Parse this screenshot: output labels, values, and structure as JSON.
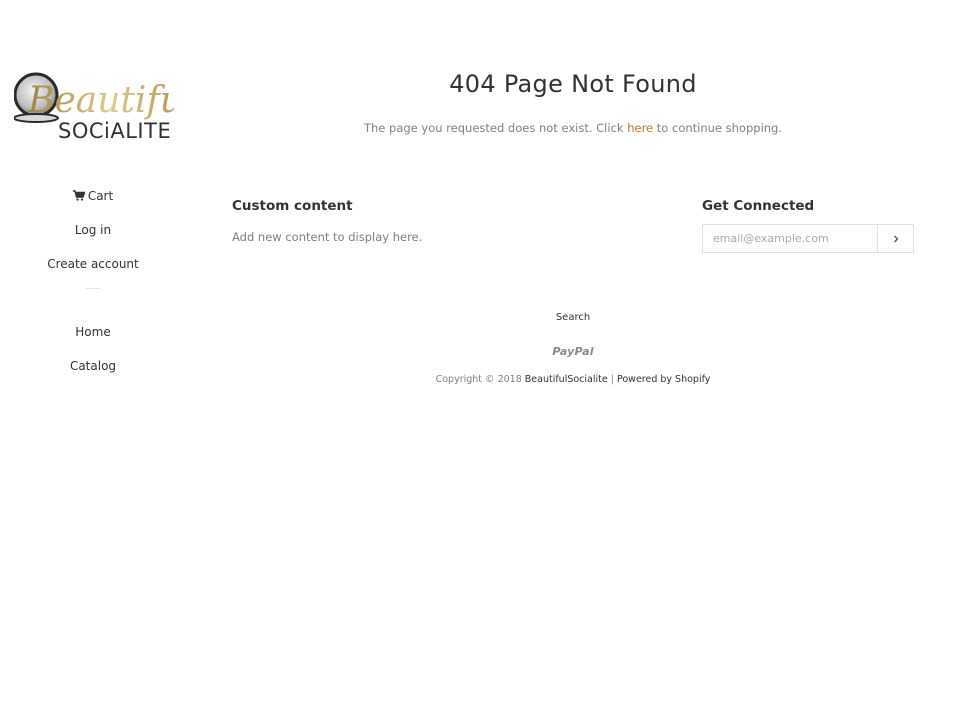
{
  "brand": {
    "logo_script": "Beautiful",
    "logo_text": "SOCiALITE",
    "gold": "#b89a4a",
    "dark": "#333333"
  },
  "sidebar": {
    "items": [
      {
        "label": "Cart",
        "icon": "cart-icon"
      },
      {
        "label": "Log in"
      },
      {
        "label": "Create account"
      },
      {
        "label": "Home"
      },
      {
        "label": "Catalog"
      }
    ]
  },
  "main": {
    "title": "404 Page Not Found",
    "message_before": "The page you requested does not exist. Click ",
    "message_link": "here",
    "message_after": " to continue shopping.",
    "link_color": "#c67436"
  },
  "footer": {
    "custom_title": "Custom content",
    "custom_text": "Add new content to display here.",
    "connected_title": "Get Connected",
    "email_placeholder": "email@example.com",
    "submit_icon": "chevron-right-icon",
    "search_label": "Search",
    "payment_label": "PayPal",
    "copyright_prefix": "Copyright © 2018 ",
    "store_name": "BeautifulSocialite",
    "separator": " | ",
    "powered_by": "Powered by Shopify"
  }
}
